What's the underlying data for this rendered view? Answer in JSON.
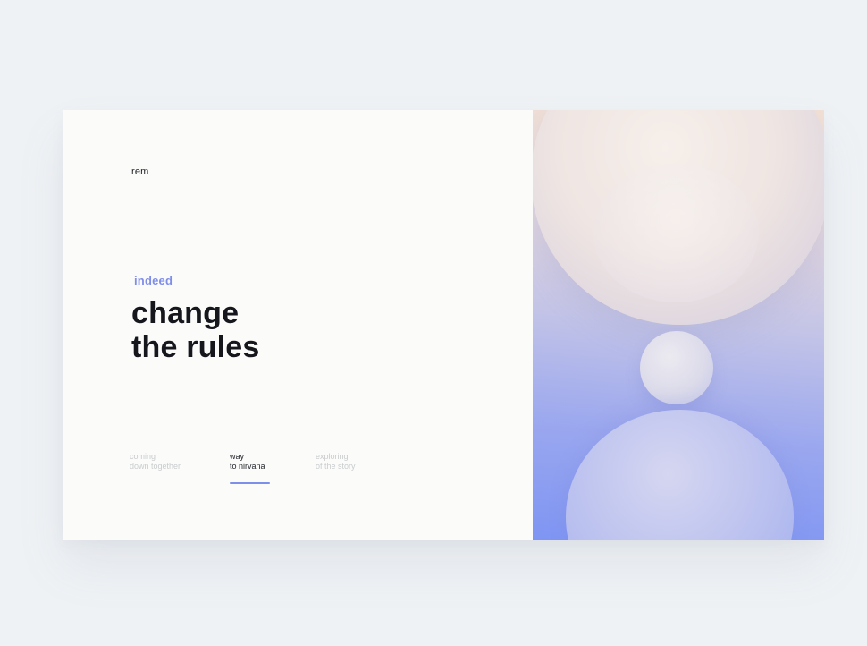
{
  "brand": {
    "name": "rem"
  },
  "hero": {
    "eyebrow": "indeed",
    "headline_line1": "change",
    "headline_line2": "the rules"
  },
  "nav": {
    "items": [
      {
        "line1": "coming",
        "line2": "down together",
        "active": false
      },
      {
        "line1": "way",
        "line2": "to nirvana",
        "active": true
      },
      {
        "line1": "exploring",
        "line2": "of the story",
        "active": false
      }
    ]
  },
  "colors": {
    "accent": "#7f8ee8",
    "page_background": "#eff2f5",
    "card_background": "#fbfbfa",
    "headline": "#15171c",
    "inactive_nav": "#c9cbcd",
    "gradient_top": "#f3e1d5",
    "gradient_bottom": "#7f95f3"
  }
}
